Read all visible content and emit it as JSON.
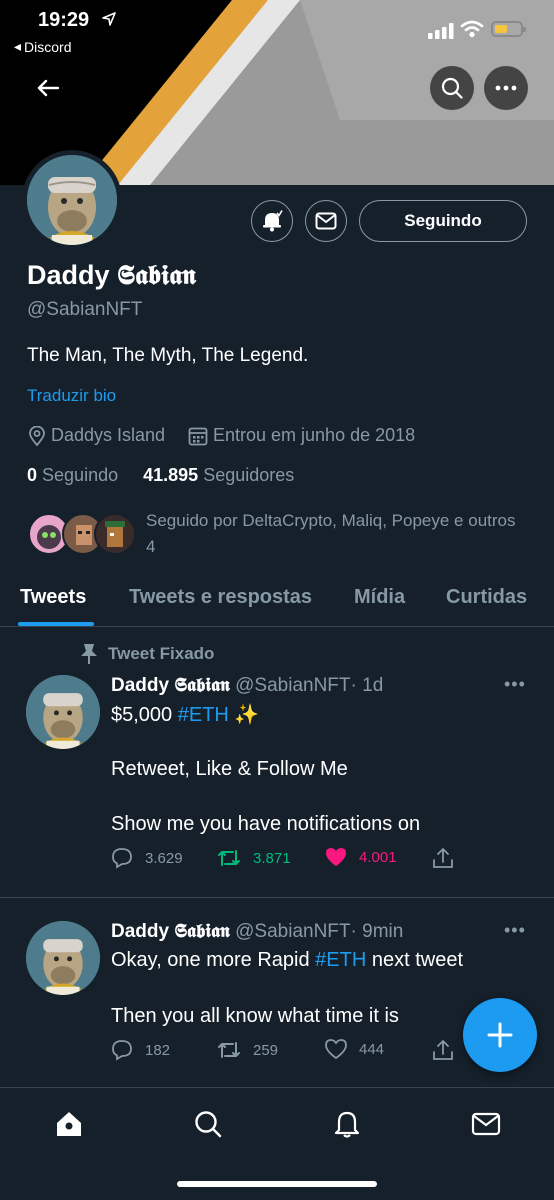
{
  "status_bar": {
    "time": "19:29",
    "back_app": "Discord"
  },
  "profile": {
    "name_prefix": "Daddy",
    "name_styled": "𝕾𝖆𝖇𝖎𝖆𝖓",
    "handle": "@SabianNFT",
    "bio": "The Man, The Myth, The Legend.",
    "translate_bio": "Traduzir bio",
    "location": "Daddys Island",
    "joined": "Entrou em junho de 2018",
    "following_count": "0",
    "following_label": "Seguindo",
    "followers_count": "41.895",
    "followers_label": "Seguidores",
    "followed_by": "Seguido por DeltaCrypto, Maliq, Popeye e outros 4",
    "follow_button": "Seguindo"
  },
  "tabs": [
    {
      "label": "Tweets",
      "active": true
    },
    {
      "label": "Tweets e respostas",
      "active": false
    },
    {
      "label": "Mídia",
      "active": false
    },
    {
      "label": "Curtidas",
      "active": false
    }
  ],
  "tweets": [
    {
      "pinned_label": "Tweet Fixado",
      "name_prefix": "Daddy",
      "name_styled": "𝕾𝖆𝖇𝖎𝖆𝖓",
      "handle": "@SabianNFT",
      "time": "· 1d",
      "line1_text": "$5,000 ",
      "line1_hashtag": "#ETH",
      "line1_emoji": " ✨",
      "line2": "Retweet, Like & Follow Me",
      "line3": "Show me you have notifications on",
      "replies": "3.629",
      "retweets": "3.871",
      "likes": "4.001",
      "liked": true,
      "retweeted": true
    },
    {
      "name_prefix": "Daddy",
      "name_styled": "𝕾𝖆𝖇𝖎𝖆𝖓",
      "handle": "@SabianNFT",
      "time": "· 9min",
      "line1_text": "Okay, one more Rapid ",
      "line1_hashtag": "#ETH",
      "line1_after": " next tweet",
      "line2": "Then you all know what time it is",
      "replies": "182",
      "retweets": "259",
      "likes": "444"
    }
  ],
  "colors": {
    "background": "#15202b",
    "accent": "#1d9bf0",
    "muted": "#8899a6",
    "like": "#f91880",
    "retweet": "#00ba7c",
    "border": "#38444d"
  },
  "icons": {
    "back": "arrow-left-icon",
    "search": "search-icon",
    "more": "more-icon",
    "notifications": "bell-icon",
    "message": "envelope-icon",
    "location": "location-pin-icon",
    "calendar": "calendar-icon",
    "pin": "pin-icon",
    "reply": "reply-icon",
    "retweet": "retweet-icon",
    "like": "heart-icon",
    "share": "share-icon",
    "compose": "plus-icon",
    "home": "home-icon",
    "explore": "search-icon",
    "bell": "bell-icon",
    "dm": "envelope-icon"
  }
}
